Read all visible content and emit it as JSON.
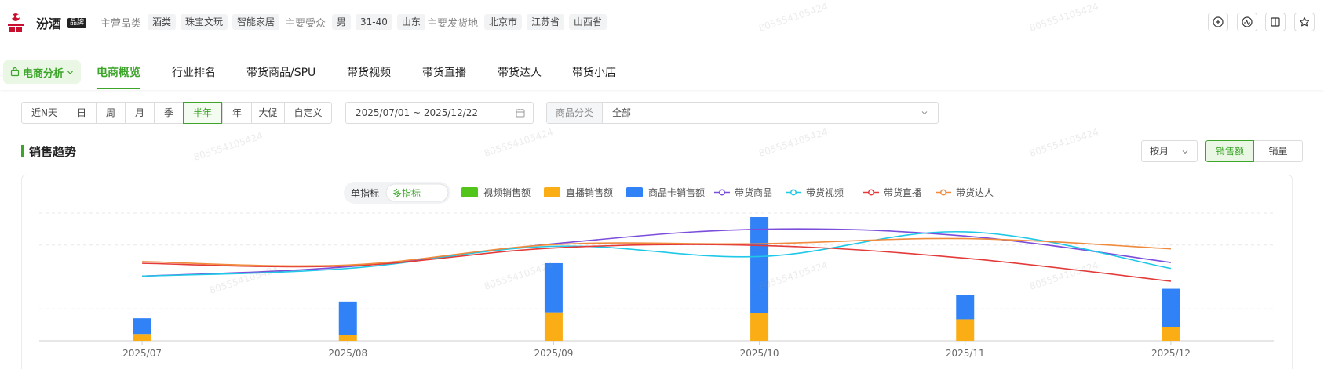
{
  "header": {
    "brand_name": "汾酒",
    "brand_badge": "品牌",
    "main_category_label": "主营品类",
    "main_categories": [
      "酒类",
      "珠宝文玩",
      "智能家居"
    ],
    "audience_label": "主要受众",
    "audience_tags": [
      "男",
      "31-40",
      "山东"
    ],
    "ship_label": "主要发货地",
    "ship_tags": [
      "北京市",
      "江苏省",
      "山西省"
    ]
  },
  "nav": {
    "dropdown_label": "电商分析",
    "tabs": [
      "电商概览",
      "行业排名",
      "带货商品/SPU",
      "带货视频",
      "带货直播",
      "带货达人",
      "带货小店"
    ]
  },
  "filters": {
    "periods": [
      "近N天",
      "日",
      "周",
      "月",
      "季",
      "半年",
      "年",
      "大促",
      "自定义"
    ],
    "active_period": "半年",
    "date_range": "2025/07/01 ~ 2025/12/22",
    "category_label": "商品分类",
    "category_value": "全部"
  },
  "section": {
    "title": "销售趋势",
    "granularity": "按月",
    "metric_options": [
      "销售额",
      "销量"
    ],
    "active_metric": "销售额"
  },
  "legend": {
    "mode_single": "单指标",
    "mode_multi": "多指标",
    "items": [
      {
        "name": "视频销售额",
        "type": "bar",
        "color": "#52c41a"
      },
      {
        "name": "直播销售额",
        "type": "bar",
        "color": "#faad14"
      },
      {
        "name": "商品卡销售额",
        "type": "bar",
        "color": "#3182f6"
      },
      {
        "name": "带货商品",
        "type": "line",
        "color": "#7b4ddb"
      },
      {
        "name": "带货视频",
        "type": "line",
        "color": "#1ec8e6"
      },
      {
        "name": "带货直播",
        "type": "line",
        "color": "#e43a3a"
      },
      {
        "name": "带货达人",
        "type": "line",
        "color": "#f08a3c"
      }
    ]
  },
  "chart_data": {
    "type": "bar",
    "categories": [
      "2025/07",
      "2025/08",
      "2025/09",
      "2025/10",
      "2025/11",
      "2025/12"
    ],
    "bar_series": [
      {
        "name": "视频销售额",
        "values": [
          0,
          0,
          0,
          0,
          0,
          0
        ]
      },
      {
        "name": "直播销售额",
        "values": [
          7,
          6,
          29,
          28,
          22,
          14
        ]
      },
      {
        "name": "商品卡销售额",
        "values": [
          16,
          34,
          50,
          98,
          25,
          39
        ]
      }
    ],
    "bar_max": 130,
    "line_series": [
      {
        "name": "带货商品",
        "values": [
          76,
          87,
          114,
          131,
          123,
          92
        ]
      },
      {
        "name": "带货视频",
        "values": [
          76,
          85,
          111,
          99,
          128,
          85
        ]
      },
      {
        "name": "带货直播",
        "values": [
          91,
          88,
          109,
          112,
          97,
          70
        ]
      },
      {
        "name": "带货达人",
        "values": [
          93,
          89,
          113,
          114,
          120,
          108
        ]
      }
    ],
    "line_max": 150,
    "grid": true,
    "legend_position": "top-center"
  },
  "colors": {
    "accent": "#3da52a"
  }
}
